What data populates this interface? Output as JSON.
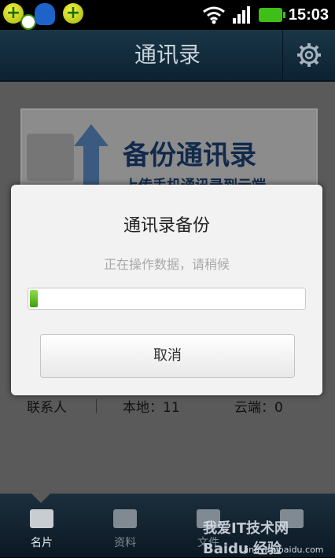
{
  "status_bar": {
    "time": "15:03",
    "icons": [
      "green-plus-check-icon",
      "qq-penguin-icon",
      "green-plus-icon",
      "wifi-icon",
      "signal-icon",
      "battery-icon"
    ]
  },
  "header": {
    "title": "通讯录",
    "settings_icon": "gear-icon"
  },
  "banner": {
    "title": "备份通讯录",
    "subtitle": "上传手机通讯录到云端"
  },
  "stats": {
    "contacts_label": "联系人",
    "local": "本地：11",
    "cloud": "云端：0"
  },
  "dialog": {
    "title": "通讯录备份",
    "message": "正在操作数据，请稍候",
    "progress": 0.02,
    "cancel_label": "取消"
  },
  "tabs": [
    {
      "label": "名片",
      "icon": "card-icon",
      "active": true
    },
    {
      "label": "资料",
      "icon": "folder-plus-icon",
      "active": false
    },
    {
      "label": "文件",
      "icon": "grid-icon",
      "active": false
    },
    {
      "label": "",
      "icon": "cloud-icon",
      "active": false
    }
  ],
  "watermark": {
    "text": "我爱IT技术网 Baidu 经验",
    "url": "jingyan.baidu.com"
  },
  "colors": {
    "header_bg": "#193647",
    "progress_green": "#3f9d10",
    "dialog_bg": "#f2f2f2"
  }
}
